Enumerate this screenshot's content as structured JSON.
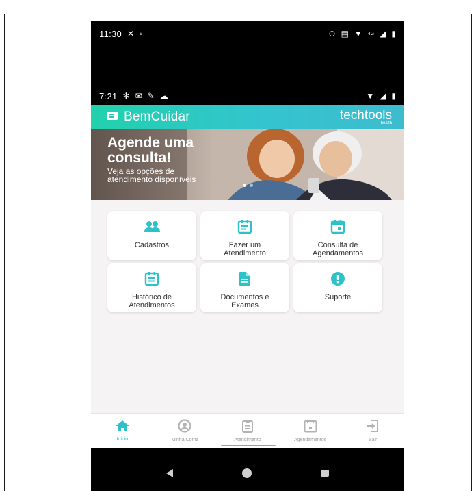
{
  "status_outer": {
    "time": "11:30",
    "network": "4G"
  },
  "status_inner": {
    "time": "7:21"
  },
  "appbar": {
    "brand": "BemCuidar",
    "partner": "techtools",
    "partner_sub": "health"
  },
  "banner": {
    "title": "Agende uma consulta!",
    "subtitle": "Veja as opções de atendimento disponíveis"
  },
  "menu": [
    {
      "label": "Cadastros",
      "icon": "users-icon"
    },
    {
      "label": "Fazer um\nAtendimento",
      "icon": "document-list-icon"
    },
    {
      "label": "Consulta de\nAgendamentos",
      "icon": "calendar-icon"
    },
    {
      "label": "Histórico de\nAtendimentos",
      "icon": "history-calendar-icon"
    },
    {
      "label": "Documentos e\nExames",
      "icon": "file-icon"
    },
    {
      "label": "Suporte",
      "icon": "alert-circle-icon"
    }
  ],
  "bottom_nav": [
    {
      "label": "Início",
      "icon": "home-icon",
      "active": true
    },
    {
      "label": "Minha Conta",
      "icon": "account-icon",
      "active": false
    },
    {
      "label": "Atendimento",
      "icon": "clipboard-icon",
      "active": false
    },
    {
      "label": "Agendamentos",
      "icon": "calendar-icon",
      "active": false
    },
    {
      "label": "Sair",
      "icon": "logout-icon",
      "active": false
    }
  ],
  "colors": {
    "accent": "#2fc1c8",
    "appbar_start": "#22d1ad",
    "appbar_end": "#3ebccf",
    "inactive": "#b3b3b3"
  }
}
